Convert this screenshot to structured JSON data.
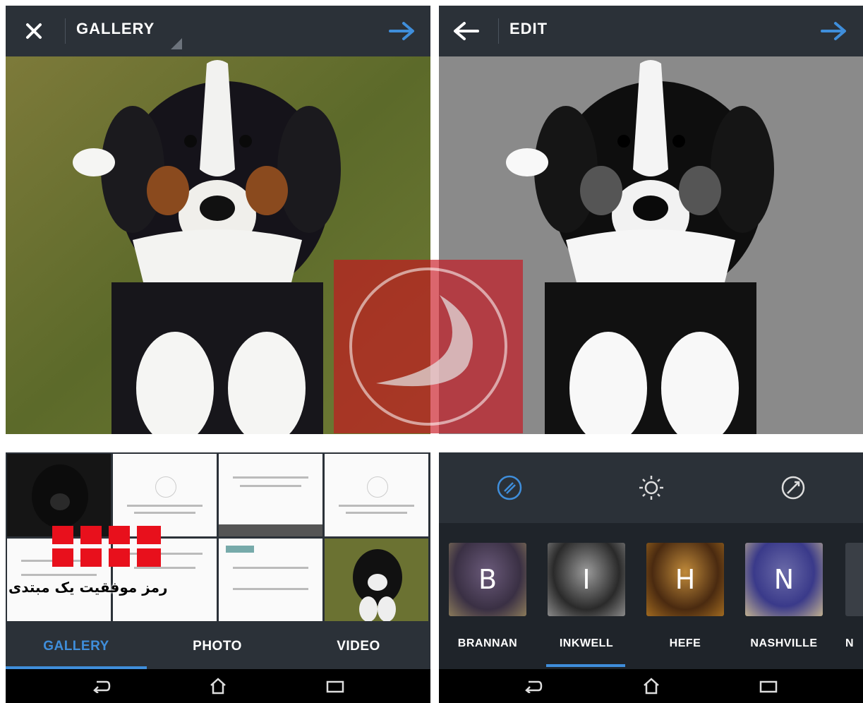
{
  "left": {
    "header": {
      "title": "GALLERY",
      "close_icon": "close-icon",
      "next_icon": "arrow-right-icon"
    },
    "tabs": [
      {
        "label": "GALLERY",
        "active": true
      },
      {
        "label": "PHOTO",
        "active": false
      },
      {
        "label": "VIDEO",
        "active": false
      }
    ]
  },
  "right": {
    "header": {
      "title": "EDIT",
      "back_icon": "arrow-left-icon",
      "next_icon": "arrow-right-icon"
    },
    "tools": [
      "lux-icon",
      "brightness-icon",
      "straighten-icon"
    ],
    "filters": [
      {
        "letter": "B",
        "name": "BRANNAN"
      },
      {
        "letter": "I",
        "name": "INKWELL"
      },
      {
        "letter": "H",
        "name": "HEFE"
      },
      {
        "letter": "N",
        "name": "NASHVILLE"
      },
      {
        "letter": "",
        "name": "N"
      }
    ],
    "selected_filter": "INKWELL"
  },
  "system_nav": [
    "back-icon",
    "home-icon",
    "recent-apps-icon"
  ],
  "watermark": {
    "text": "رمز موفقیت یک مبتدی"
  },
  "colors": {
    "bar": "#2b3138",
    "accent": "#3f8edb",
    "watermark": "#c8141e"
  }
}
